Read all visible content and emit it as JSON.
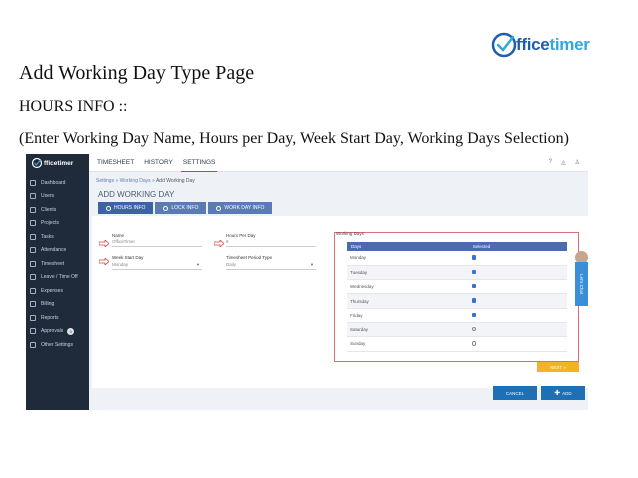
{
  "slide": {
    "title": "Add Working Day Type Page",
    "subtitle": "HOURS INFO ::",
    "description": "(Enter Working Day Name, Hours  per Day, Week Start Day, Working Days Selection)",
    "logo_text_main": "ffice",
    "logo_text_accent": "timer"
  },
  "app": {
    "sidebar_logo": "fficetimer",
    "sidebar_items": [
      {
        "label": "Dashboard"
      },
      {
        "label": "Users"
      },
      {
        "label": "Clients"
      },
      {
        "label": "Projects"
      },
      {
        "label": "Tasks"
      },
      {
        "label": "Attendance"
      },
      {
        "label": "Timesheet"
      },
      {
        "label": "Leave / Time Off"
      },
      {
        "label": "Expenses"
      },
      {
        "label": "Billing"
      },
      {
        "label": "Reports"
      },
      {
        "label": "Approvals",
        "badge": "0"
      },
      {
        "label": "Other Settings"
      }
    ],
    "top_tabs": [
      "TIMESHEET",
      "HISTORY",
      "SETTINGS"
    ],
    "breadcrumb": [
      "Settings",
      "Working Days",
      "Add Working Day"
    ],
    "section_title": "ADD WORKING DAY",
    "form_tabs": [
      "HOURS INFO",
      "LOCK INFO",
      "WORK DAY INFO"
    ],
    "fields": {
      "name_label": "Name",
      "name_value": "OfficeTimer",
      "hours_label": "Hours Per Day",
      "hours_value": "8",
      "week_start_label": "Week Start Day",
      "week_start_value": "Monday",
      "period_label": "Timesheet Period Type",
      "period_value": "Daily"
    },
    "working_days": {
      "title": "Working Days",
      "col_days": "Days",
      "col_selected": "Selected",
      "rows": [
        {
          "day": "Monday",
          "selected": true
        },
        {
          "day": "Tuesday",
          "selected": true
        },
        {
          "day": "Wednesday",
          "selected": true
        },
        {
          "day": "Thursday",
          "selected": true
        },
        {
          "day": "Friday",
          "selected": true
        },
        {
          "day": "Saturday",
          "selected": false
        },
        {
          "day": "Sunday",
          "selected": false
        }
      ]
    },
    "next_label": "NEXT »",
    "cancel_label": "CANCEL",
    "add_label": "ADD",
    "chat_label": "Let's Chat",
    "colors": {
      "accent": "#3a6fd8",
      "sidebar": "#1f2a3a",
      "next": "#f5b324",
      "button": "#1f6fb5"
    }
  }
}
